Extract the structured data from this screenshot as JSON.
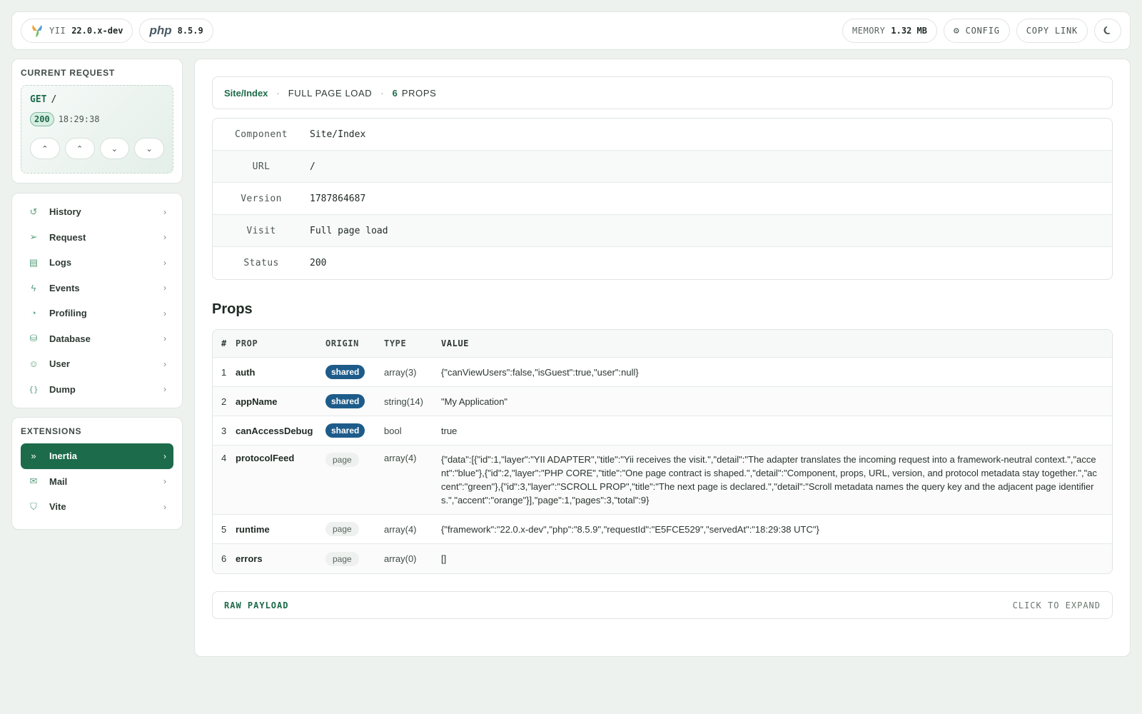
{
  "topbar": {
    "yii_label": "YII",
    "yii_version": "22.0.x-dev",
    "php_label": "php",
    "php_version": "8.5.9",
    "memory_label": "MEMORY",
    "memory_value": "1.32 MB",
    "config_label": "CONFIG",
    "copy_link_label": "COPY LINK"
  },
  "request": {
    "section_title": "CURRENT REQUEST",
    "method": "GET",
    "path": "/",
    "status": "200",
    "time": "18:29:38"
  },
  "menu": {
    "items": [
      {
        "label": "History",
        "icon": "history-icon"
      },
      {
        "label": "Request",
        "icon": "send-icon"
      },
      {
        "label": "Logs",
        "icon": "file-icon"
      },
      {
        "label": "Events",
        "icon": "bolt-icon"
      },
      {
        "label": "Profiling",
        "icon": "gauge-icon"
      },
      {
        "label": "Database",
        "icon": "database-icon"
      },
      {
        "label": "User",
        "icon": "user-icon"
      },
      {
        "label": "Dump",
        "icon": "braces-icon"
      }
    ]
  },
  "extensions": {
    "title": "EXTENSIONS",
    "items": [
      {
        "label": "Inertia",
        "active": true
      },
      {
        "label": "Mail",
        "active": false
      },
      {
        "label": "Vite",
        "active": false
      }
    ]
  },
  "summary": {
    "component": "Site/Index",
    "load": "FULL PAGE LOAD",
    "props_count": "6",
    "props_label": "PROPS"
  },
  "details": [
    {
      "key": "Component",
      "value": "Site/Index"
    },
    {
      "key": "URL",
      "value": "/"
    },
    {
      "key": "Version",
      "value": "1787864687"
    },
    {
      "key": "Visit",
      "value": "Full page load"
    },
    {
      "key": "Status",
      "value": "200"
    }
  ],
  "props": {
    "title": "Props",
    "columns": [
      "#",
      "PROP",
      "ORIGIN",
      "TYPE",
      "VALUE"
    ],
    "rows": [
      {
        "n": "1",
        "prop": "auth",
        "origin": "shared",
        "type": "array(3)",
        "value": "{\"canViewUsers\":false,\"isGuest\":true,\"user\":null}"
      },
      {
        "n": "2",
        "prop": "appName",
        "origin": "shared",
        "type": "string(14)",
        "value": "\"My Application\""
      },
      {
        "n": "3",
        "prop": "canAccessDebug",
        "origin": "shared",
        "type": "bool",
        "value": "true"
      },
      {
        "n": "4",
        "prop": "protocolFeed",
        "origin": "page",
        "type": "array(4)",
        "value": "{\"data\":[{\"id\":1,\"layer\":\"YII ADAPTER\",\"title\":\"Yii receives the visit.\",\"detail\":\"The adapter translates the incoming request into a framework-neutral context.\",\"accent\":\"blue\"},{\"id\":2,\"layer\":\"PHP CORE\",\"title\":\"One page contract is shaped.\",\"detail\":\"Component, props, URL, version, and protocol metadata stay together.\",\"accent\":\"green\"},{\"id\":3,\"layer\":\"SCROLL PROP\",\"title\":\"The next page is declared.\",\"detail\":\"Scroll metadata names the query key and the adjacent page identifiers.\",\"accent\":\"orange\"}],\"page\":1,\"pages\":3,\"total\":9}"
      },
      {
        "n": "5",
        "prop": "runtime",
        "origin": "page",
        "type": "array(4)",
        "value": "{\"framework\":\"22.0.x-dev\",\"php\":\"8.5.9\",\"requestId\":\"E5FCE529\",\"servedAt\":\"18:29:38 UTC\"}"
      },
      {
        "n": "6",
        "prop": "errors",
        "origin": "page",
        "type": "array(0)",
        "value": "[]"
      }
    ]
  },
  "raw_payload": {
    "title": "RAW PAYLOAD",
    "hint": "CLICK TO EXPAND"
  },
  "colors": {
    "accent_green": "#1c6b4a",
    "shared_badge": "#1d5c8a",
    "background": "#eef2ef"
  }
}
